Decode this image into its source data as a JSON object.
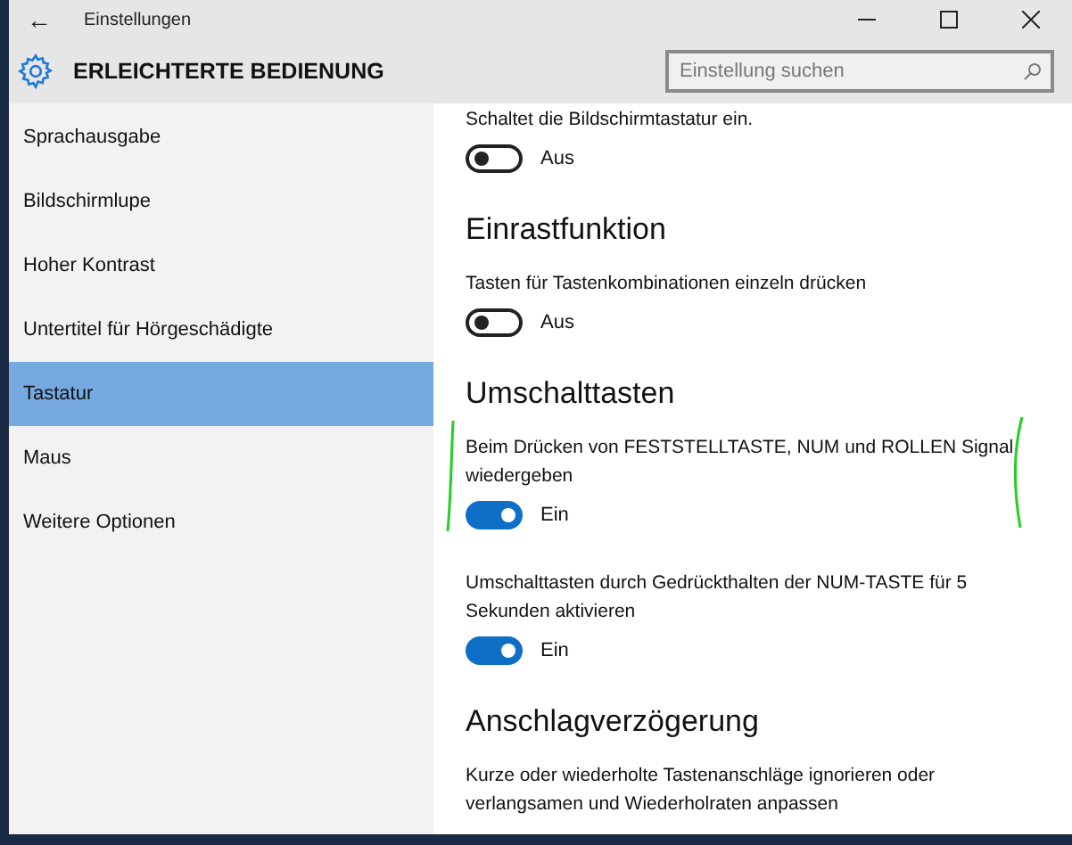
{
  "window": {
    "title": "Einstellungen",
    "back": "←"
  },
  "header": {
    "title": "ERLEICHTERTE BEDIENUNG",
    "search": {
      "placeholder": "Einstellung suchen"
    }
  },
  "sidebar": {
    "items": [
      {
        "label": "Sprachausgabe",
        "selected": false
      },
      {
        "label": "Bildschirmlupe",
        "selected": false
      },
      {
        "label": "Hoher Kontrast",
        "selected": false
      },
      {
        "label": "Untertitel für Hörgeschädigte",
        "selected": false
      },
      {
        "label": "Tastatur",
        "selected": true
      },
      {
        "label": "Maus",
        "selected": false
      },
      {
        "label": "Weitere Optionen",
        "selected": false
      }
    ]
  },
  "content": [
    {
      "kind": "setting",
      "description": "Schaltet die Bildschirmtastatur ein.",
      "on": false,
      "state_label": "Aus"
    },
    {
      "kind": "heading",
      "text": "Einrastfunktion"
    },
    {
      "kind": "setting",
      "description": "Tasten für Tastenkombinationen einzeln drücken",
      "on": false,
      "state_label": "Aus"
    },
    {
      "kind": "heading",
      "text": "Umschalttasten"
    },
    {
      "kind": "setting",
      "description": "Beim Drücken von FESTSTELLTASTE, NUM und ROLLEN Signal wiedergeben",
      "on": true,
      "state_label": "Ein",
      "marked": true
    },
    {
      "kind": "setting",
      "description": "Umschalttasten durch Gedrückthalten der NUM-TASTE für 5 Sekunden aktivieren",
      "on": true,
      "state_label": "Ein"
    },
    {
      "kind": "heading",
      "text": "Anschlagverzögerung"
    },
    {
      "kind": "paragraph",
      "text": "Kurze oder wiederholte Tastenanschläge ignorieren oder verlangsamen und Wiederholraten anpassen"
    }
  ]
}
